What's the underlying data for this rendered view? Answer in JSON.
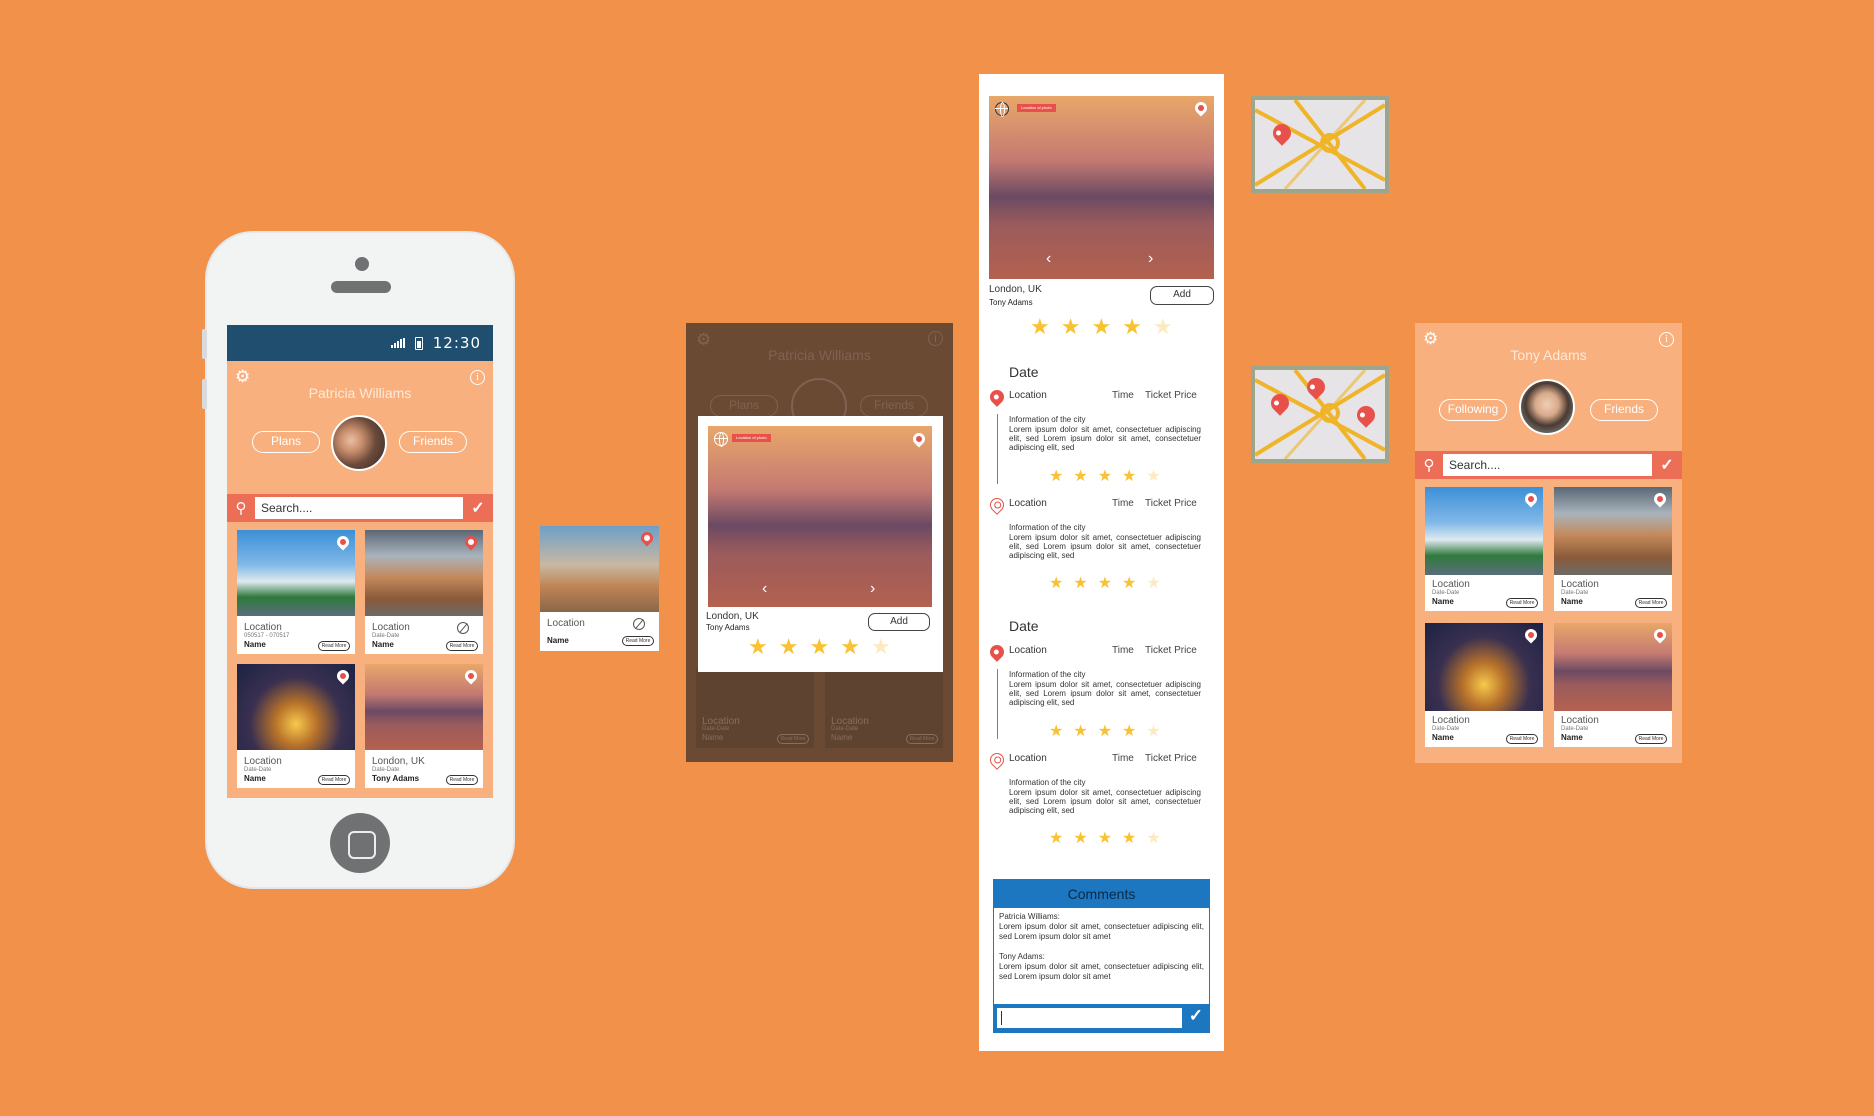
{
  "statusbar": {
    "time": "12:30"
  },
  "phone_screen": {
    "user_name": "Patricia Williams",
    "left_pill": "Plans",
    "right_pill": "Friends",
    "search_placeholder": "Search....",
    "cards": [
      {
        "title": "Location",
        "subtitle": "050517 - 070517",
        "name": "Name",
        "button": "Read More"
      },
      {
        "title": "Location",
        "subtitle": "Date-Date",
        "name": "Name",
        "button": "Read More"
      },
      {
        "title": "Location",
        "subtitle": "Date-Date",
        "name": "Name",
        "button": "Read More"
      },
      {
        "title": "London, UK",
        "subtitle": "Date-Date",
        "name": "Tony Adams",
        "button": "Read More"
      }
    ]
  },
  "single_card": {
    "title": "Location",
    "name": "Name",
    "button": "Read More"
  },
  "popup_screen": {
    "ghost_name": "Patricia Williams",
    "ghost_left": "Plans",
    "ghost_right": "Friends",
    "place": "London, UK",
    "author": "Tony Adams",
    "add_label": "Add",
    "tag": "Location of photo",
    "rating": 4,
    "ghost_cards": [
      {
        "title": "Location",
        "subtitle": "Date-Date",
        "name": "Name",
        "button": "Read More"
      },
      {
        "title": "Location",
        "subtitle": "Date-Date",
        "name": "Name",
        "button": "Read More"
      }
    ]
  },
  "detail": {
    "place": "London, UK",
    "author": "Tony Adams",
    "add_label": "Add",
    "tag": "Location of photo",
    "rating": 4,
    "sections": [
      {
        "title": "Date",
        "rows": [
          {
            "location": "Location",
            "time": "Time",
            "price": "Ticket Price",
            "info": "Information of the city",
            "text": "Lorem ipsum dolor sit amet, consectetuer adipiscing elit, sed Lorem ipsum dolor sit amet, consectetuer adipiscing elit, sed",
            "rating": 4
          },
          {
            "location": "Location",
            "time": "Time",
            "price": "Ticket Price",
            "info": "Information of the city",
            "text": "Lorem ipsum dolor sit amet, consectetuer adipiscing elit, sed Lorem ipsum dolor sit amet, consectetuer adipiscing elit, sed",
            "rating": 4
          }
        ]
      },
      {
        "title": "Date",
        "rows": [
          {
            "location": "Location",
            "time": "Time",
            "price": "Ticket Price",
            "info": "Information of the city",
            "text": "Lorem ipsum dolor sit amet, consectetuer adipiscing elit, sed Lorem ipsum dolor sit amet, consectetuer adipiscing elit, sed",
            "rating": 4
          },
          {
            "location": "Location",
            "time": "Time",
            "price": "Ticket Price",
            "info": "Information of the city",
            "text": "Lorem ipsum dolor sit amet, consectetuer adipiscing elit, sed Lorem ipsum dolor sit amet, consectetuer adipiscing elit, sed",
            "rating": 4
          }
        ]
      }
    ],
    "comments": {
      "title": "Comments",
      "items": [
        {
          "author": "Patricia Williams:",
          "text": "Lorem ipsum dolor sit amet, consectetuer adipiscing elit, sed Lorem ipsum dolor sit amet"
        },
        {
          "author": "Tony Adams:",
          "text": "Lorem ipsum dolor sit amet, consectetuer adipiscing elit, sed Lorem ipsum dolor sit amet"
        }
      ],
      "input_value": ""
    }
  },
  "tony_screen": {
    "user_name": "Tony Adams",
    "left_pill": "Following",
    "right_pill": "Friends",
    "search_placeholder": "Search....",
    "cards": [
      {
        "title": "Location",
        "subtitle": "Date-Date",
        "name": "Name",
        "button": "Read More"
      },
      {
        "title": "Location",
        "subtitle": "Date-Date",
        "name": "Name",
        "button": "Read More"
      },
      {
        "title": "Location",
        "subtitle": "Date-Date",
        "name": "Name",
        "button": "Read More"
      },
      {
        "title": "Location",
        "subtitle": "Date-Date",
        "name": "Name",
        "button": "Read More"
      }
    ]
  },
  "colors": {
    "background": "#F2924A",
    "status_bar": "#1F4E6E",
    "profile_bg": "#F8B07E",
    "search_bar": "#EC6E57",
    "star": "#F8C232",
    "pin": "#E8514A",
    "comments": "#1C77C0"
  }
}
